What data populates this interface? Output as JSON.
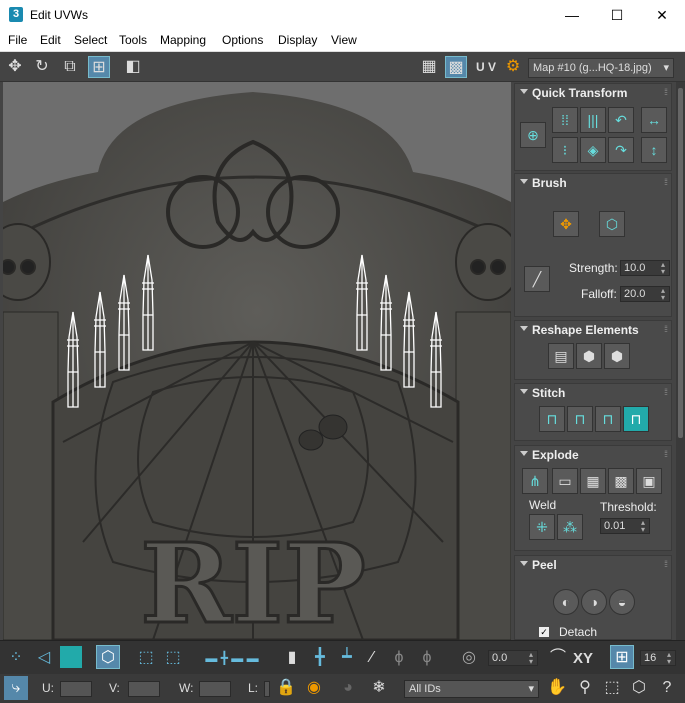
{
  "window": {
    "title": "Edit UVWs",
    "app_icon": "3",
    "minimize": "—",
    "maximize": "☐",
    "close": "✕"
  },
  "menu": [
    "File",
    "Edit",
    "Select",
    "Tools",
    "Mapping",
    "Options",
    "Display",
    "View"
  ],
  "toolbar": {
    "uv_label": "U V",
    "map_select": "Map #10 (g...HQ-18.jpg)"
  },
  "viewport": {
    "engraving": "RIP"
  },
  "panel": {
    "quick_transform": {
      "title": "Quick Transform"
    },
    "brush": {
      "title": "Brush",
      "strength_label": "Strength:",
      "strength_value": "10.0",
      "falloff_label": "Falloff:",
      "falloff_value": "20.0"
    },
    "reshape": {
      "title": "Reshape Elements"
    },
    "stitch": {
      "title": "Stitch"
    },
    "explode": {
      "title": "Explode",
      "weld_label": "Weld",
      "threshold_label": "Threshold:",
      "threshold_value": "0.01"
    },
    "peel": {
      "title": "Peel",
      "detach_label": "Detach"
    }
  },
  "bottom": {
    "spin_value": "0.0",
    "xy_label": "XY",
    "grid_value": "16",
    "u_label": "U:",
    "v_label": "V:",
    "w_label": "W:",
    "l_label": "L:",
    "ids_select": "All IDs"
  },
  "colors": {
    "accent": "#2aa8b0",
    "panel": "#444444",
    "title_bg": "#ffffff"
  }
}
